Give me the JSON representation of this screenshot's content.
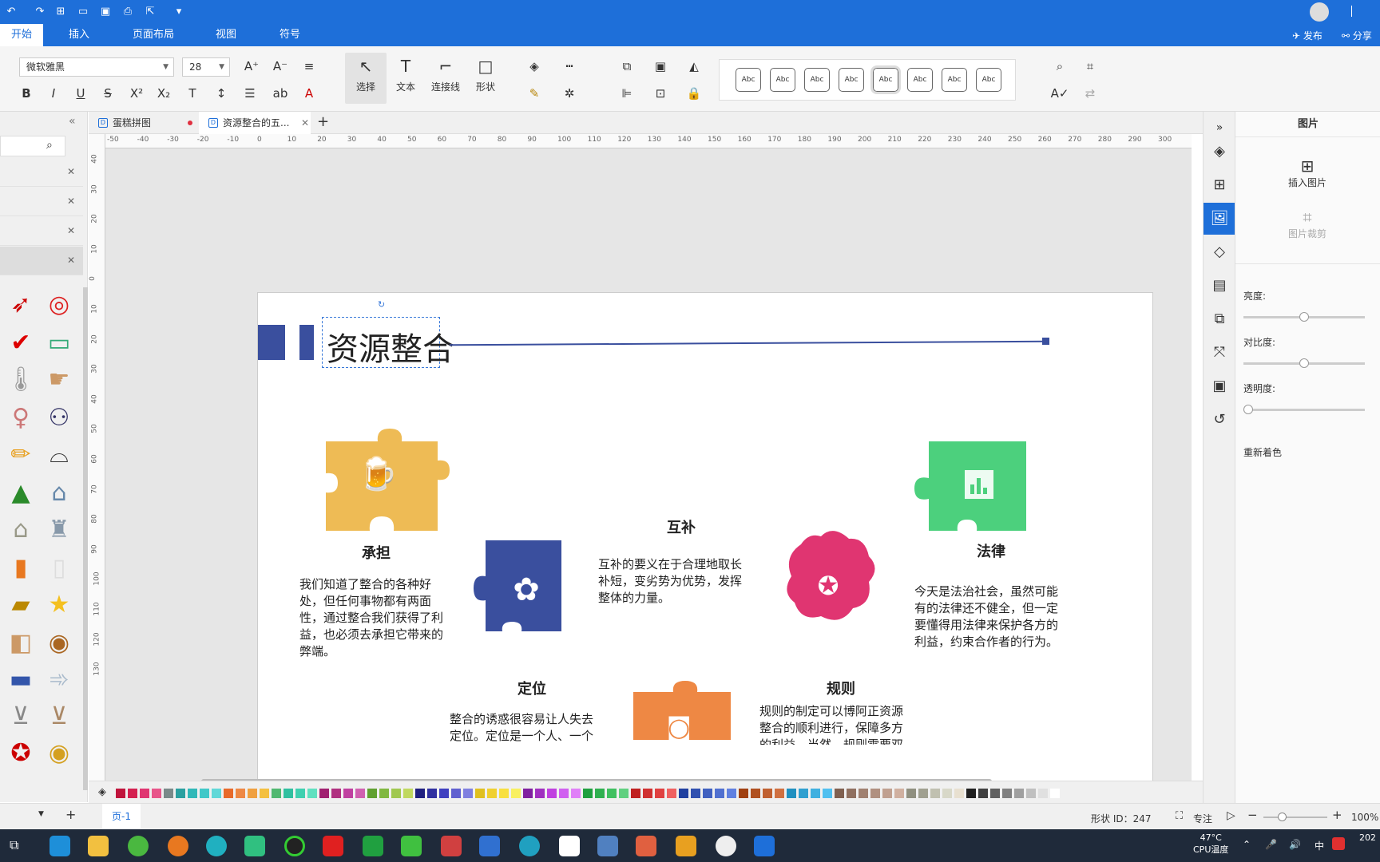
{
  "titlebar": {
    "publish": "发布",
    "share": "分享"
  },
  "menu": {
    "items": [
      "开始",
      "插入",
      "页面布局",
      "视图",
      "符号"
    ],
    "active": "开始"
  },
  "ribbon": {
    "font_name": "微软雅黑",
    "font_size": "28",
    "tools": {
      "select": "选择",
      "text": "文本",
      "connector": "连接线",
      "shape": "形状"
    },
    "style_label": "Abc"
  },
  "tabs": [
    {
      "label": "蛋糕拼图",
      "modified": true
    },
    {
      "label": "资源整合的五...",
      "active": true
    }
  ],
  "ruler": {
    "h": [
      "-50",
      "-40",
      "-30",
      "-20",
      "-10",
      "0",
      "10",
      "20",
      "30",
      "40",
      "50",
      "60",
      "70",
      "80",
      "90",
      "100",
      "110",
      "120",
      "130",
      "140",
      "150",
      "160",
      "170",
      "180",
      "190",
      "200",
      "210",
      "220",
      "230",
      "240",
      "250",
      "260",
      "270",
      "280",
      "290",
      "300"
    ],
    "v": [
      "40",
      "30",
      "20",
      "10",
      "0",
      "10",
      "20",
      "30",
      "40",
      "50",
      "60",
      "70",
      "80",
      "90",
      "100",
      "110",
      "120",
      "130"
    ]
  },
  "diagram": {
    "title": "资源整合",
    "items": [
      {
        "title": "承担",
        "color": "#eebb55",
        "text": "我们知道了整合的各种好处，但任何事物都有两面性，通过整合我们获得了利益，也必须去承担它带来的弊端。"
      },
      {
        "title": "定位",
        "color": "#3a4f9e",
        "text": "整合的诱惑很容易让人失去定位。定位是一个人、一个产品、一个企业、一个组织"
      },
      {
        "title": "互补",
        "color": "#ee8844",
        "text": "互补的要义在于合理地取长补短，变劣势为优势，发挥整体的力量。"
      },
      {
        "title": "规则",
        "color": "#e03571",
        "text": "规则的制定可以博阿正资源整合的顺利进行，保障多方的利益。当然，规则需要双"
      },
      {
        "title": "法律",
        "color": "#4cd07d",
        "text": "今天是法治社会，虽然可能有的法律还不健全，但一定要懂得用法律来保护各方的利益，约束合作者的行为。"
      }
    ]
  },
  "palette": [
    "#c0143c",
    "#d42050",
    "#e03571",
    "#e8558a",
    "#7a8a8a",
    "#2aa0a0",
    "#30b8b8",
    "#40c8c8",
    "#60d8d8",
    "#e86a2a",
    "#ee8844",
    "#f0a040",
    "#f4c040",
    "#50b870",
    "#30c0a0",
    "#40d0b0",
    "#60e0c0",
    "#a02070",
    "#b03080",
    "#c040a0",
    "#d060b0",
    "#60a030",
    "#80b840",
    "#a0c850",
    "#c0d860",
    "#202080",
    "#3030a0",
    "#4040c0",
    "#6060d0",
    "#8080e0",
    "#e0c020",
    "#f0d030",
    "#f8e040",
    "#f8f060",
    "#8020a0",
    "#a030c0",
    "#c040e0",
    "#d060f0",
    "#e080f8",
    "#20a040",
    "#30b050",
    "#40c060",
    "#60d080",
    "#c02020",
    "#d03030",
    "#e04040",
    "#f06060",
    "#2040a0",
    "#3050b0",
    "#4060c0",
    "#5070d0",
    "#6080e0",
    "#a04010",
    "#b05020",
    "#c06030",
    "#d07040",
    "#2090c0",
    "#30a0d0",
    "#40b0e0",
    "#50c0f0",
    "#806050",
    "#907060",
    "#a08070",
    "#b09080",
    "#c0a090",
    "#d0b0a0",
    "#909080",
    "#a0a090",
    "#c0c0b0",
    "#d8d8c8",
    "#e8e0d0",
    "#202020",
    "#404040",
    "#606060",
    "#808080",
    "#a0a0a0",
    "#c0c0c0",
    "#e0e0e0",
    "#ffffff"
  ],
  "status": {
    "page": "页-1",
    "shape_id": "形状 ID：247",
    "focus": "专注",
    "zoom": "100%"
  },
  "rightpanel": {
    "title": "图片",
    "insert": "插入图片",
    "crop": "图片裁剪",
    "brightness": "亮度:",
    "contrast": "对比度:",
    "transparency": "透明度:",
    "recolor": "重新着色",
    "brightness_value": 0.5,
    "contrast_value": 0.5,
    "transparency_value": 0.0
  },
  "taskbar": {
    "temp": "47°C",
    "cpu": "CPU温度",
    "ime": "中",
    "year": "202"
  }
}
